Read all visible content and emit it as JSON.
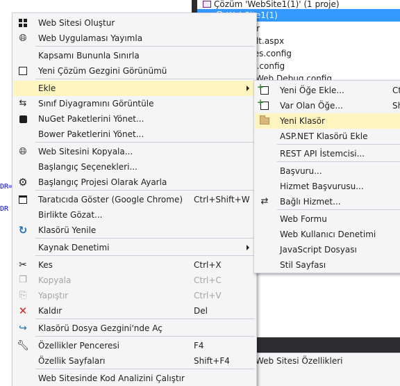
{
  "background": {
    "solution_tree": [
      {
        "text": "Çözüm 'WebSite1(1)' (1 proje)",
        "selected": false,
        "kind": "solution"
      },
      {
        "text": "WebSite1(1)",
        "selected": true,
        "kind": "website"
      },
      {
        "text": "yalar",
        "selected": false,
        "kind": "file"
      },
      {
        "text": "ault.aspx",
        "selected": false,
        "kind": "file"
      },
      {
        "text": "kages.config",
        "selected": false,
        "kind": "file"
      },
      {
        "text": "b.config",
        "selected": false,
        "kind": "file"
      },
      {
        "text": "Web.Debug.config",
        "selected": false,
        "kind": "file"
      }
    ],
    "properties_title": "Web Sitesi Özellikleri",
    "code_fragments": [
      "DR=",
      "DR"
    ]
  },
  "context_menu": {
    "items": [
      {
        "label": "Web Sitesi Oluştur",
        "icon": "build-icon",
        "shortcut": "",
        "disabled": false,
        "submenu": false
      },
      {
        "label": "Web Uygulaması Yayımla",
        "icon": "publish-globe-icon",
        "shortcut": "",
        "disabled": false,
        "submenu": false
      },
      {
        "separator": true
      },
      {
        "label": "Kapsamı Bununla Sınırla",
        "icon": "",
        "shortcut": "",
        "disabled": false,
        "submenu": false
      },
      {
        "label": "Yeni Çözüm Gezgini Görünümü",
        "icon": "new-view-icon",
        "shortcut": "",
        "disabled": false,
        "submenu": false
      },
      {
        "separator": true
      },
      {
        "label": "Ekle",
        "icon": "",
        "shortcut": "",
        "disabled": false,
        "submenu": true,
        "highlighted": true
      },
      {
        "label": "Sınıf Diyagramını Görüntüle",
        "icon": "class-diagram-icon",
        "shortcut": "",
        "disabled": false,
        "submenu": false
      },
      {
        "label": "NuGet Paketlerini Yönet...",
        "icon": "nuget-icon",
        "shortcut": "",
        "disabled": false,
        "submenu": false
      },
      {
        "label": "Bower Paketlerini Yönet...",
        "icon": "",
        "shortcut": "",
        "disabled": false,
        "submenu": false
      },
      {
        "separator": true
      },
      {
        "label": "Web Sitesini Kopyala...",
        "icon": "copy-website-icon",
        "shortcut": "",
        "disabled": false,
        "submenu": false
      },
      {
        "label": "Başlangıç Seçenekleri...",
        "icon": "",
        "shortcut": "",
        "disabled": false,
        "submenu": false
      },
      {
        "label": "Başlangıç Projesi Olarak Ayarla",
        "icon": "gear-icon",
        "shortcut": "",
        "disabled": false,
        "submenu": false
      },
      {
        "separator": true
      },
      {
        "label": "Taratıcıda Göster (Google Chrome)",
        "icon": "browser-icon",
        "shortcut": "Ctrl+Shift+W",
        "disabled": false,
        "submenu": false
      },
      {
        "label": "Birlikte Gözat...",
        "icon": "",
        "shortcut": "",
        "disabled": false,
        "submenu": false
      },
      {
        "label": "Klasörü Yenile",
        "icon": "refresh-icon",
        "shortcut": "",
        "disabled": false,
        "submenu": false
      },
      {
        "separator": true
      },
      {
        "label": "Kaynak Denetimi",
        "icon": "",
        "shortcut": "",
        "disabled": false,
        "submenu": true
      },
      {
        "separator": true
      },
      {
        "label": "Kes",
        "icon": "scissors-icon",
        "shortcut": "Ctrl+X",
        "disabled": false,
        "submenu": false
      },
      {
        "label": "Kopyala",
        "icon": "copy-icon",
        "shortcut": "Ctrl+C",
        "disabled": true,
        "submenu": false
      },
      {
        "label": "Yapıştır",
        "icon": "paste-icon",
        "shortcut": "Ctrl+V",
        "disabled": true,
        "submenu": false
      },
      {
        "label": "Kaldır",
        "icon": "delete-x-icon",
        "shortcut": "Del",
        "disabled": false,
        "submenu": false
      },
      {
        "separator": true
      },
      {
        "label": "Klasörü Dosya Gezgini'nde Aç",
        "icon": "open-folder-arrow-icon",
        "shortcut": "",
        "disabled": false,
        "submenu": false
      },
      {
        "separator": true
      },
      {
        "label": "Özellikler Penceresi",
        "icon": "wrench-icon",
        "shortcut": "F4",
        "disabled": false,
        "submenu": false
      },
      {
        "label": "Özellik Sayfaları",
        "icon": "",
        "shortcut": "Shift+F4",
        "disabled": false,
        "submenu": false
      },
      {
        "separator": true
      },
      {
        "label": "Web Sitesinde Kod Analizini Çalıştır",
        "icon": "",
        "shortcut": "",
        "disabled": false,
        "submenu": false
      }
    ]
  },
  "submenu": {
    "items": [
      {
        "label": "Yeni Öğe Ekle...",
        "icon": "new-item-icon",
        "shortcut": "Ct",
        "highlighted": false
      },
      {
        "label": "Var Olan Öğe...",
        "icon": "existing-item-icon",
        "shortcut": "Sh",
        "highlighted": false
      },
      {
        "label": "Yeni Klasör",
        "icon": "new-folder-icon",
        "shortcut": "",
        "highlighted": true
      },
      {
        "label": "ASP.NET Klasörü Ekle",
        "icon": "",
        "shortcut": "",
        "highlighted": false
      },
      {
        "separator": true
      },
      {
        "label": "REST API İstemcisi...",
        "icon": "",
        "shortcut": "",
        "highlighted": false
      },
      {
        "separator": true
      },
      {
        "label": "Başvuru...",
        "icon": "",
        "shortcut": "",
        "highlighted": false
      },
      {
        "label": "Hizmet Başvurusu...",
        "icon": "",
        "shortcut": "",
        "highlighted": false
      },
      {
        "label": "Bağlı Hizmet...",
        "icon": "connected-service-icon",
        "shortcut": "",
        "highlighted": false
      },
      {
        "separator": true
      },
      {
        "label": "Web Formu",
        "icon": "",
        "shortcut": "",
        "highlighted": false
      },
      {
        "label": "Web Kullanıcı Denetimi",
        "icon": "",
        "shortcut": "",
        "highlighted": false
      },
      {
        "label": "JavaScript Dosyası",
        "icon": "",
        "shortcut": "",
        "highlighted": false
      },
      {
        "label": "Stil Sayfası",
        "icon": "",
        "shortcut": "",
        "highlighted": false
      }
    ]
  },
  "colors": {
    "menu_bg": "#f5f5f5",
    "menu_border": "#cccedb",
    "highlight": "#fdf4bf",
    "selection": "#3399ff",
    "disabled_text": "#a2a4a5",
    "panel_dark": "#2d2d30"
  }
}
